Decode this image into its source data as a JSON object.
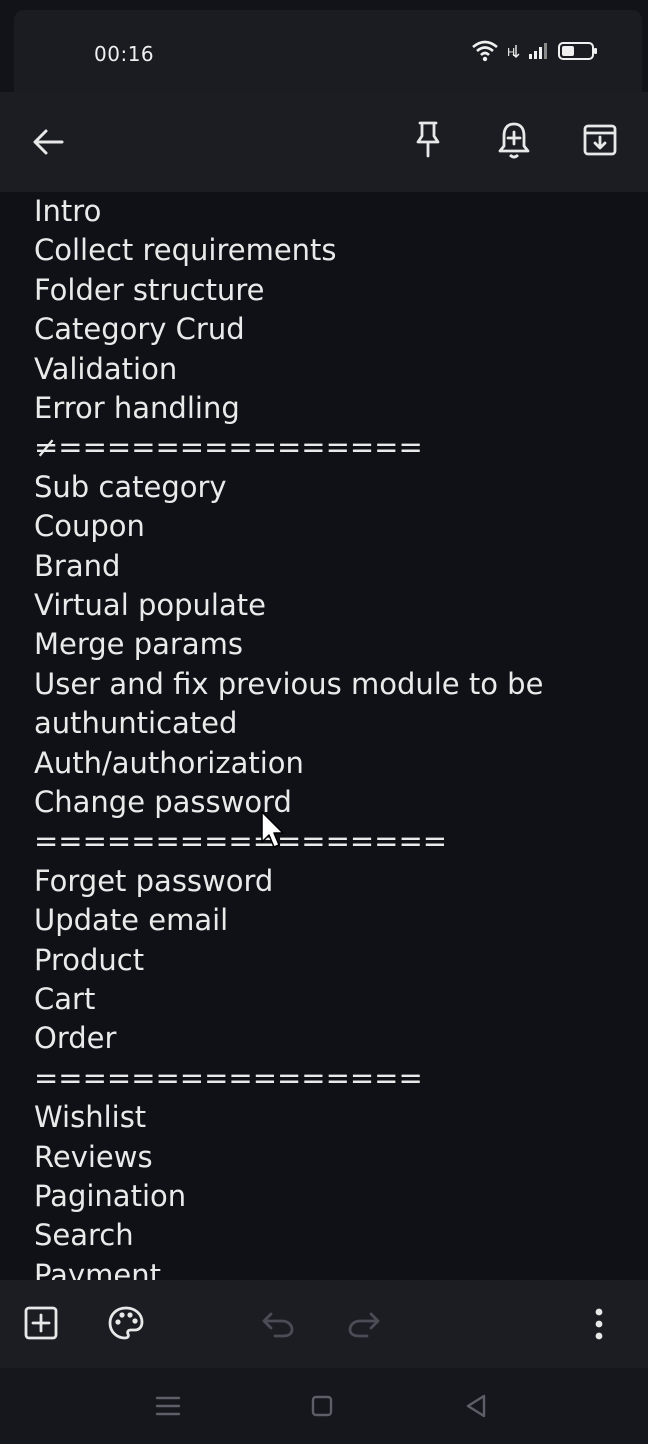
{
  "status_bar": {
    "time": "00:16"
  },
  "toolbar": {
    "back_icon": "arrow-left-icon",
    "pin_icon": "pin-icon",
    "reminder_icon": "reminder-bell-icon",
    "archive_icon": "archive-icon"
  },
  "note": {
    "lines": [
      "Intro",
      "Collect requirements",
      "Folder structure",
      "Category Crud",
      "Validation",
      "Error handling",
      "≠===============",
      "Sub category",
      "Coupon",
      "Brand",
      "Virtual populate",
      "Merge params",
      "User  and fix previous module to be",
      "authunticated",
      "Auth/authorization",
      "Change password",
      "=================",
      "Forget password",
      "Update email",
      "Product",
      "Cart",
      "Order",
      "================",
      "Wishlist",
      "Reviews",
      "Pagination",
      "Search",
      "Payment"
    ]
  },
  "bottom_bar": {
    "add_icon": "add-box-icon",
    "palette_icon": "palette-icon",
    "undo_icon": "undo-icon",
    "redo_icon": "redo-icon",
    "more_icon": "more-vert-icon"
  },
  "nav_bar": {
    "menu_icon": "recents-icon",
    "home_icon": "home-icon",
    "back_icon": "nav-back-icon"
  }
}
